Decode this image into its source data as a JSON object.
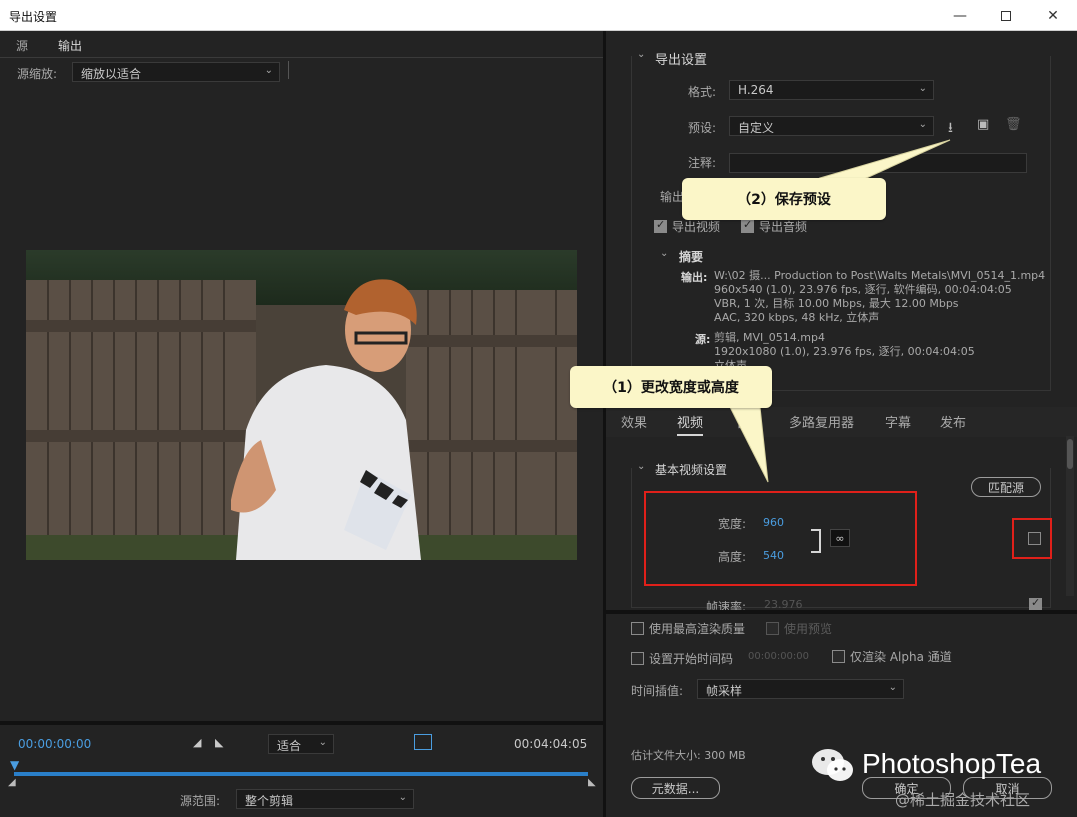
{
  "window": {
    "title": "导出设置"
  },
  "left": {
    "tabs": [
      "源",
      "输出"
    ],
    "source_scale_label": "源缩放:",
    "source_scale_value": "缩放以适合",
    "timecode_start": "00:00:00:00",
    "timecode_end": "00:04:04:05",
    "fit_value": "适合",
    "source_range_label": "源范围:",
    "source_range_value": "整个剪辑"
  },
  "export": {
    "section_title": "导出设置",
    "format_label": "格式:",
    "format_value": "H.264",
    "preset_label": "预设:",
    "preset_value": "自定义",
    "comment_label": "注释:",
    "output_label_partial": "输出",
    "export_video": "导出视频",
    "export_audio": "导出音频",
    "summary_title": "摘要",
    "summary_output_label": "输出:",
    "summary_output_lines": [
      "W:\\02 摄... Production to Post\\Walts Metals\\MVI_0514_1.mp4",
      "960x540 (1.0), 23.976 fps, 逐行, 软件编码, 00:04:04:05",
      "VBR, 1 次, 目标 10.00 Mbps, 最大 12.00 Mbps",
      "AAC, 320 kbps, 48 kHz, 立体声"
    ],
    "summary_source_label": "源:",
    "summary_source_lines": [
      "剪辑, MVI_0514.mp4",
      "1920x1080 (1.0), 23.976 fps, 逐行, 00:04:04:05",
      "立体声"
    ]
  },
  "callouts": {
    "save_preset": "（2）保存预设",
    "change_size": "（1）更改宽度或高度"
  },
  "subtabs": [
    "效果",
    "视频",
    "音频",
    "多路复用器",
    "字幕",
    "发布"
  ],
  "video": {
    "section_title": "基本视频设置",
    "match_source": "匹配源",
    "width_label": "宽度:",
    "width_value": "960",
    "height_label": "高度:",
    "height_value": "540",
    "framerate_label": "帧速率:",
    "framerate_value": "23.976"
  },
  "bottom": {
    "max_render_quality": "使用最高渲染质量",
    "use_preview": "使用预览",
    "set_start_timecode": "设置开始时间码",
    "start_timecode_value": "00:00:00:00",
    "render_alpha_only": "仅渲染 Alpha 通道",
    "time_interp_label": "时间插值:",
    "time_interp_value": "帧采样",
    "est_file_size": "估计文件大小: 300 MB",
    "metadata_button": "元数据...",
    "ok_button": "确定",
    "cancel_button": "取消"
  },
  "watermark": {
    "brand": "PhotoshopTea",
    "community": "@稀土掘金技术社区"
  }
}
